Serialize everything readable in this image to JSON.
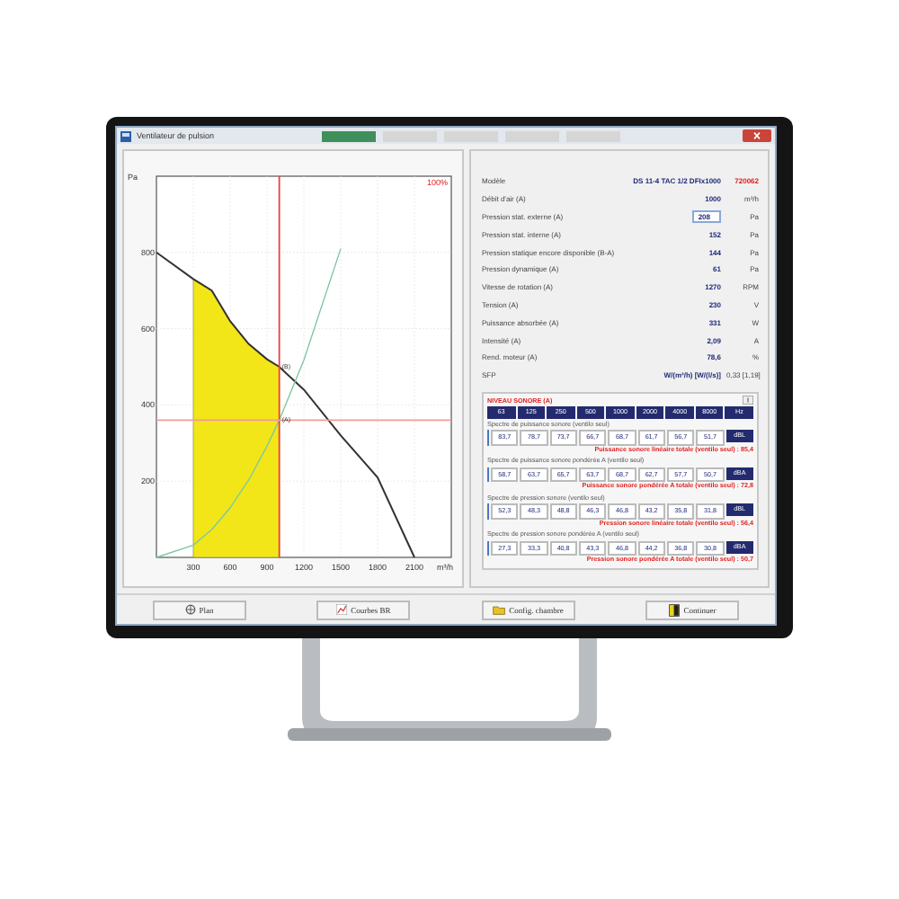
{
  "window": {
    "title": "Ventilateur de pulsion"
  },
  "chart": {
    "chart_data": {
      "type": "line",
      "xlabel": "m³/h",
      "ylabel": "Pa",
      "x": [
        0,
        300,
        450,
        600,
        750,
        900,
        1000,
        1200,
        1500,
        1800,
        2100
      ],
      "series": [
        {
          "color": "#333333",
          "values": [
            800,
            730,
            700,
            620,
            560,
            520,
            500,
            440,
            320,
            210,
            0
          ]
        },
        {
          "color": "#7fc8a0",
          "values": [
            0,
            32,
            73,
            130,
            203,
            292,
            360,
            518,
            810,
            null,
            null
          ]
        }
      ],
      "xlim": [
        0,
        2400
      ],
      "ylim": [
        0,
        1000
      ],
      "xticks": [
        300,
        600,
        900,
        1200,
        1500,
        1800,
        2100
      ],
      "yticks": [
        200,
        400,
        600,
        800
      ],
      "grid": true,
      "bands": [
        {
          "axis": "x",
          "from": 300,
          "to": 1000,
          "color": "#f2e619"
        }
      ],
      "ref_lines": [
        {
          "axis": "x",
          "value": 1000,
          "color": "#e8423c"
        },
        {
          "axis": "y",
          "value": 360,
          "color": "#f29a96"
        }
      ],
      "annotations": [
        {
          "text": "100%"
        },
        {
          "text": "(B)",
          "x": 1000,
          "y": 500
        },
        {
          "text": "(A)",
          "x": 1000,
          "y": 360
        }
      ]
    }
  },
  "model": {
    "label": "Modèle",
    "value": "DS 11-4 TAC 1/2 DFIx1000",
    "code": "720062"
  },
  "properties": [
    {
      "kind": "text",
      "label": "Débit d'air (A)",
      "value": "1000",
      "unit": "m³/h"
    },
    {
      "kind": "input",
      "label": "Pression stat. externe (A)",
      "value": "208",
      "unit": "Pa"
    },
    {
      "kind": "text",
      "label": "Pression stat. interne (A)",
      "value": "152",
      "unit": "Pa"
    },
    {
      "kind": "text",
      "label": "Pression statique encore disponible (B-A)",
      "value": "144",
      "unit": "Pa"
    },
    {
      "kind": "text",
      "label": "Pression dynamique (A)",
      "value": "61",
      "unit": "Pa"
    },
    {
      "kind": "text",
      "label": "Vitesse de rotation (A)",
      "value": "1270",
      "unit": "RPM"
    },
    {
      "kind": "text",
      "label": "Tension (A)",
      "value": "230",
      "unit": "V"
    },
    {
      "kind": "text",
      "label": "Puissance absorbée (A)",
      "value": "331",
      "unit": "W"
    },
    {
      "kind": "text",
      "label": "Intensité (A)",
      "value": "2,09",
      "unit": "A"
    },
    {
      "kind": "text",
      "label": "Rend. moteur (A)",
      "value": "78,6",
      "unit": "%"
    },
    {
      "kind": "text",
      "label": "SFP",
      "value": "W/(m³/h)  [W/(l/s)]",
      "unit": "0,33  [1,19]"
    }
  ],
  "sound": {
    "title": "NIVEAU SONORE (A)",
    "bands": [
      "63",
      "125",
      "250",
      "500",
      "1000",
      "2000",
      "4000",
      "8000",
      "Hz"
    ],
    "spectra": [
      {
        "title": "Spectre de puissance sonore (ventilo seul)",
        "values": [
          "83,7",
          "78,7",
          "73,7",
          "66,7",
          "68,7",
          "61,7",
          "56,7",
          "51,7"
        ],
        "unit": "dBL",
        "total": "Puissance sonore linéaire totale (ventilo seul) : 85,4"
      },
      {
        "title": "Spectre de puissance sonore pondérée A (ventilo seul)",
        "values": [
          "58,7",
          "63,7",
          "65,7",
          "63,7",
          "68,7",
          "62,7",
          "57,7",
          "50,7"
        ],
        "unit": "dBA",
        "total": "Puissance sonore pondérée A totale (ventilo seul) : 72,8"
      },
      {
        "title": "Spectre de pression sonore (ventilo seul)",
        "values": [
          "52,3",
          "48,3",
          "48,8",
          "46,3",
          "46,8",
          "43,2",
          "35,8",
          "31,8"
        ],
        "unit": "dBL",
        "total": "Pression sonore linéaire totale (ventilo seul) : 56,4"
      },
      {
        "title": "Spectre de pression sonore pondérée A (ventilo seul)",
        "values": [
          "27,3",
          "33,3",
          "40,8",
          "43,3",
          "46,8",
          "44,2",
          "36,8",
          "30,8"
        ],
        "unit": "dBA",
        "total": "Pression sonore pondérée A totale (ventilo seul) : 50,7"
      }
    ]
  },
  "buttons": [
    {
      "kind": "plan",
      "label": "Plan"
    },
    {
      "kind": "curves",
      "label": "Courbes BR"
    },
    {
      "kind": "room",
      "label": "Config. chambre"
    },
    {
      "kind": "next",
      "label": "Continuer"
    }
  ]
}
